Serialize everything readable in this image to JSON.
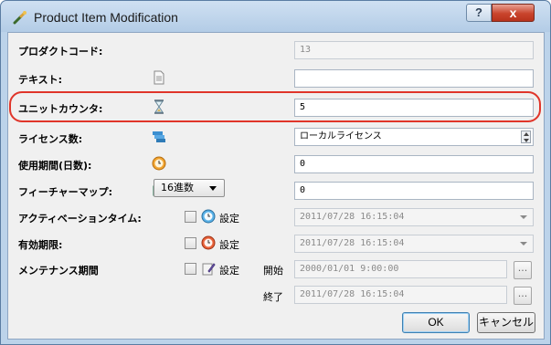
{
  "window": {
    "title": "Product Item Modification",
    "help_label": "?",
    "close_label": "x"
  },
  "rows": [
    {
      "label": "プロダクトコード:",
      "value": "13",
      "disabled": true
    },
    {
      "label": "テキスト:",
      "value": "",
      "icon": "document-icon"
    },
    {
      "label": "ユニットカウンタ:",
      "value": "5",
      "icon": "hourglass-icon"
    },
    {
      "label": "ライセンス数:",
      "value": "ローカルライセンス",
      "icon": "license-stack-icon"
    },
    {
      "label": "使用期間(日数):",
      "value": "0",
      "icon": "clock-icon"
    },
    {
      "label": "フィーチャーマップ:",
      "value": "0",
      "icon": "puzzle-icon",
      "combo": "16進数"
    },
    {
      "label": "アクティベーションタイム:",
      "value": "2011/07/28 16:15:04",
      "disabled": true,
      "check_label": "設定",
      "icon": "clock-icon"
    },
    {
      "label": "有効期限:",
      "value": "2011/07/28 16:15:04",
      "disabled": true,
      "check_label": "設定",
      "icon": "clock-red-icon"
    },
    {
      "label": "メンテナンス期間",
      "check_label": "設定",
      "icon": "pencil-doc-icon"
    }
  ],
  "maintenance": {
    "start_label": "開始",
    "start_value": "2000/01/01 9:00:00",
    "end_label": "終了",
    "end_value": "2011/07/28 16:15:04",
    "ellipsis": "..."
  },
  "buttons": {
    "ok": "OK",
    "cancel": "キャンセル"
  },
  "colors": {
    "highlight": "#e0352a",
    "title_bar": "#bcd3ea",
    "close_button": "#c9442c"
  }
}
